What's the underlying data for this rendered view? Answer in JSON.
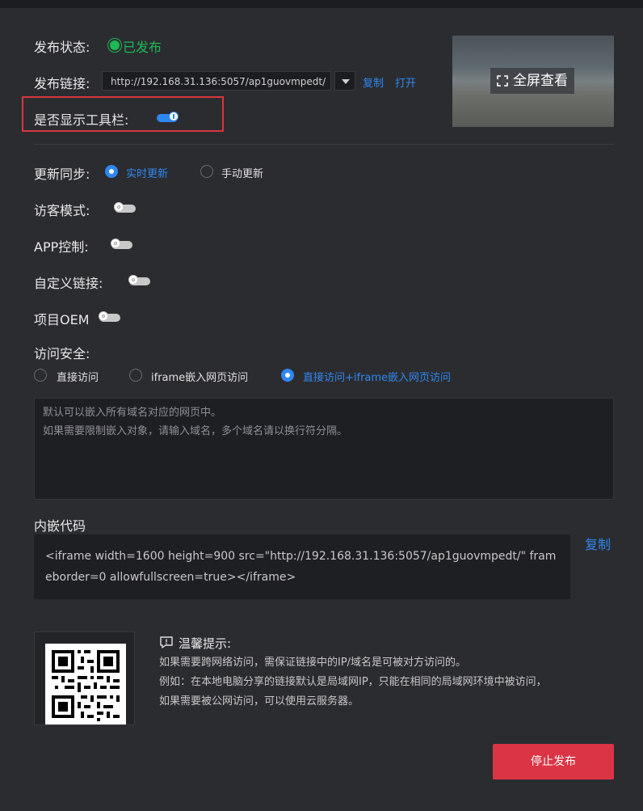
{
  "publish": {
    "status_label": "发布状态:",
    "status_value": "已发布",
    "link_label": "发布链接:",
    "link_value": "http://192.168.31.136:5057/ap1guovmpedt/",
    "copy_label": "复制",
    "open_label": "打开",
    "toolbar_label": "是否显示工具栏:",
    "toolbar_on": true
  },
  "preview": {
    "fullscreen_label": "全屏查看",
    "fullscreen_icon": "expand-icon"
  },
  "sync": {
    "label": "更新同步:",
    "options": [
      "实时更新",
      "手动更新"
    ],
    "selected": "实时更新"
  },
  "toggles": {
    "guest_label": "访客模式:",
    "guest_on": false,
    "app_label": "APP控制:",
    "app_on": false,
    "custom_link_label": "自定义链接:",
    "custom_link_on": false,
    "oem_label": "项目OEM",
    "oem_on": false
  },
  "security": {
    "label": "访问安全:",
    "options": [
      "直接访问",
      "iframe嵌入网页访问",
      "直接访问+iframe嵌入网页访问"
    ],
    "selected": "直接访问+iframe嵌入网页访问",
    "textarea_lines": [
      "默认可以嵌入所有域名对应的网页中。",
      "如果需要限制嵌入对象，请输入域名，多个域名请以换行符分隔。"
    ]
  },
  "embed": {
    "label": "内嵌代码",
    "copy_label": "复制",
    "code": "<iframe width=1600 height=900 src=\"http://192.168.31.136:5057/ap1guovmpedt/\" frameborder=0 allowfullscreen=true></iframe>"
  },
  "tips": {
    "title": "温馨提示:",
    "icon": "message-alert-icon",
    "lines": [
      "如果需要跨网络访问，需保证链接中的IP/域名是可被对方访问的。",
      "例如：在本地电脑分享的链接默认是局域网IP，只能在相同的局域网环境中被访问，",
      "如果需要被公网访问，可以使用云服务器。"
    ]
  },
  "actions": {
    "stop_label": "停止发布"
  },
  "colors": {
    "accent": "#2f88f0",
    "success": "#1db954",
    "danger": "#db3545",
    "highlight_border": "#d9363e"
  }
}
